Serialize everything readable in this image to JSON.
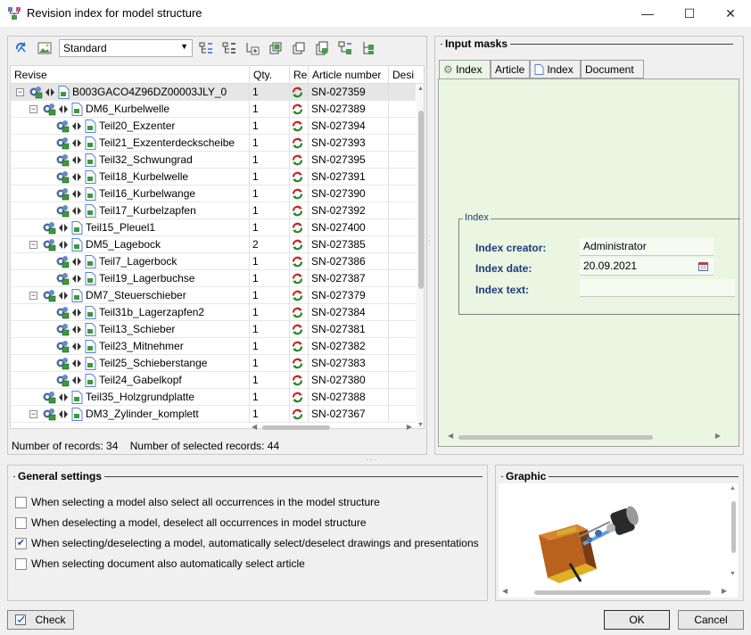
{
  "window": {
    "title": "Revision index for model structure",
    "minimize": "—",
    "maximize": "☐",
    "close": "✕"
  },
  "toolbar": {
    "view_value": "Standard"
  },
  "grid": {
    "columns": [
      "Revise",
      "Qty.",
      "Re",
      "Article number",
      "Desi"
    ],
    "rows": [
      {
        "name": "B003GACO4Z96DZ00003JLY_0",
        "qty": "1",
        "article": "SN-027359"
      },
      {
        "name": "DM6_Kurbelwelle",
        "qty": "1",
        "article": "SN-027389"
      },
      {
        "name": "Teil20_Exzenter",
        "qty": "1",
        "article": "SN-027394"
      },
      {
        "name": "Teil21_Exzenterdeckscheibe",
        "qty": "1",
        "article": "SN-027393"
      },
      {
        "name": "Teil32_Schwungrad",
        "qty": "1",
        "article": "SN-027395"
      },
      {
        "name": "Teil18_Kurbelwelle",
        "qty": "1",
        "article": "SN-027391"
      },
      {
        "name": "Teil16_Kurbelwange",
        "qty": "1",
        "article": "SN-027390"
      },
      {
        "name": "Teil17_Kurbelzapfen",
        "qty": "1",
        "article": "SN-027392"
      },
      {
        "name": "Teil15_Pleuel1",
        "qty": "1",
        "article": "SN-027400"
      },
      {
        "name": "DM5_Lagebock",
        "qty": "2",
        "article": "SN-027385"
      },
      {
        "name": "Teil7_Lagerbock",
        "qty": "1",
        "article": "SN-027386"
      },
      {
        "name": "Teil19_Lagerbuchse",
        "qty": "1",
        "article": "SN-027387"
      },
      {
        "name": "DM7_Steuerschieber",
        "qty": "1",
        "article": "SN-027379"
      },
      {
        "name": "Teil31b_Lagerzapfen2",
        "qty": "1",
        "article": "SN-027384"
      },
      {
        "name": "Teil13_Schieber",
        "qty": "1",
        "article": "SN-027381"
      },
      {
        "name": "Teil23_Mitnehmer",
        "qty": "1",
        "article": "SN-027382"
      },
      {
        "name": "Teil25_Schieberstange",
        "qty": "1",
        "article": "SN-027383"
      },
      {
        "name": "Teil24_Gabelkopf",
        "qty": "1",
        "article": "SN-027380"
      },
      {
        "name": "Teil35_Holzgrundplatte",
        "qty": "1",
        "article": "SN-027388"
      },
      {
        "name": "DM3_Zylinder_komplett",
        "qty": "1",
        "article": "SN-027367"
      }
    ],
    "records_text": "Number of records: 34",
    "selected_text": "Number of selected records: 44"
  },
  "input_masks": {
    "title": "Input masks",
    "tabs": [
      "Index",
      "Article",
      "Index",
      "Document"
    ],
    "index_group": {
      "title": "Index",
      "creator_label": "Index creator:",
      "creator_value": "Administrator",
      "date_label": "Index date:",
      "date_value": "20.09.2021",
      "text_label": "Index text:",
      "text_value": ""
    }
  },
  "general_settings": {
    "title": "General settings",
    "options": [
      {
        "label": "When selecting a model also select all occurrences in the model structure",
        "checked": false
      },
      {
        "label": "When deselecting a model, deselect all occurrences in model structure",
        "checked": false
      },
      {
        "label": "When selecting/deselecting a model, automatically select/deselect drawings and presentations",
        "checked": true
      },
      {
        "label": "When selecting document also automatically select article",
        "checked": false
      }
    ]
  },
  "graphic": {
    "title": "Graphic"
  },
  "buttons": {
    "check": "Check",
    "ok": "OK",
    "cancel": "Cancel"
  },
  "colors": {
    "tab_body": "#eaf6e2",
    "label_blue": "#1d3b7a",
    "selected_row": "#e6e6e6"
  }
}
